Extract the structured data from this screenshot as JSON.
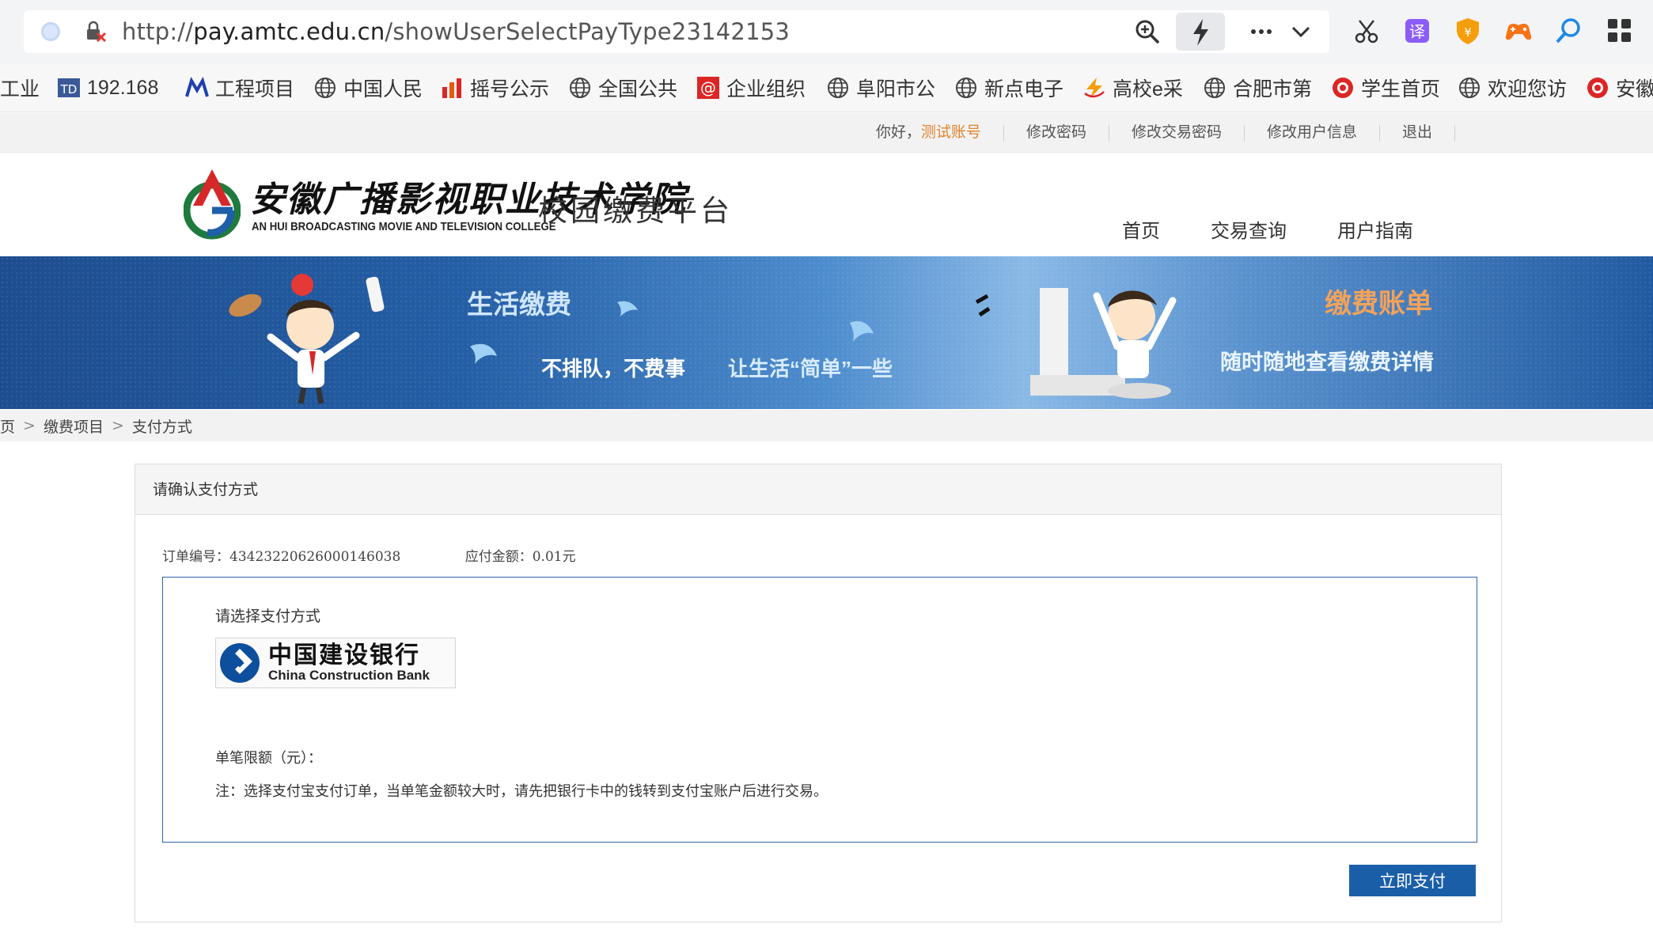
{
  "browser": {
    "url_scheme_host_prefix": "http://",
    "url_host": "pay.amtc.edu.cn",
    "url_path": "/showUserSelectPayType23142153",
    "bookmarks": [
      {
        "label": "工业",
        "icon": "page-icon"
      },
      {
        "label": "192.168",
        "icon": "td-icon"
      },
      {
        "label": "工程项目",
        "icon": "m-logo-icon"
      },
      {
        "label": "中国人民",
        "icon": "globe-icon"
      },
      {
        "label": "摇号公示",
        "icon": "bar-chart-icon"
      },
      {
        "label": "全国公共",
        "icon": "globe-icon"
      },
      {
        "label": "企业组织",
        "icon": "at-icon"
      },
      {
        "label": "阜阳市公",
        "icon": "globe-icon"
      },
      {
        "label": "新点电子",
        "icon": "globe-icon"
      },
      {
        "label": "高校e采",
        "icon": "lightning-logo-icon"
      },
      {
        "label": "合肥市第",
        "icon": "globe-icon"
      },
      {
        "label": "学生首页",
        "icon": "red-circle-icon"
      },
      {
        "label": "欢迎您访",
        "icon": "globe-icon"
      },
      {
        "label": "安徽",
        "icon": "red-circle-icon"
      }
    ]
  },
  "topbar": {
    "greeting": "你好，",
    "username": "测试账号",
    "links": [
      "修改密码",
      "修改交易密码",
      "修改用户信息",
      "退出"
    ]
  },
  "header": {
    "school_cn": "安徽广播影视职业技术学院",
    "school_en": "AN HUI BROADCASTING MOVIE AND TELEVISION COLLEGE",
    "platform": "校园缴费平台",
    "nav": [
      "首页",
      "交易查询",
      "用户指南"
    ]
  },
  "banner": {
    "t1": "生活缴费",
    "t2": "不排队，不费事",
    "t3": "让生活“简单”一些",
    "t4": "缴费账单",
    "t5": "随时随地查看缴费详情"
  },
  "breadcrumb": [
    "页",
    "缴费项目",
    "支付方式"
  ],
  "panel": {
    "title": "请确认支付方式",
    "order_label": "订单编号：",
    "order_no": "43423220626000146038",
    "amount_label": "应付金额：",
    "amount": "0.01元",
    "select_title": "请选择支付方式",
    "bank_cn": "中国建设银行",
    "bank_en": "China Construction Bank",
    "limit": "单笔限额（元）：",
    "note": "注：选择支付宝支付订单，当单笔金额较大时，请先把银行卡中的钱转到支付宝账户后进行交易。",
    "pay_button": "立即支付"
  },
  "colors": {
    "accent": "#1a5ea8",
    "username": "#e0832e",
    "select_border": "#2e62a8"
  }
}
